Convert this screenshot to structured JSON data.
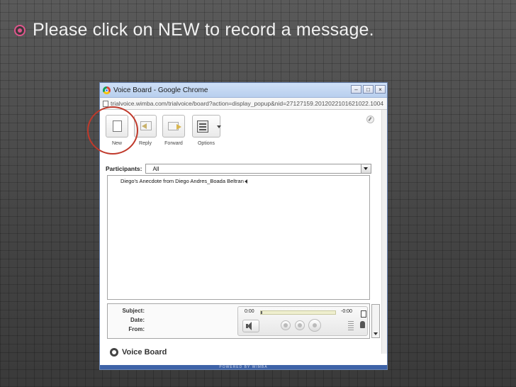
{
  "slide": {
    "bullet_text": "Please click on NEW to record a message."
  },
  "window": {
    "title": "Voice Board - Google Chrome",
    "url": "trialvoice.wimba.com/trialvoice/board?action=display_popup&nid=27127159.2012022101621022.1004",
    "controls": {
      "minimize": "–",
      "maximize": "□",
      "close": "×"
    }
  },
  "toolbar": {
    "new_label": "New",
    "reply_label": "Reply",
    "forward_label": "Forward",
    "options_label": "Options"
  },
  "participants": {
    "label": "Participants:",
    "selected": "All"
  },
  "messages": [
    {
      "title": "Diego's Anecdote",
      "separator": "from",
      "author": "Diego Andres_Boada Beltran"
    }
  ],
  "player": {
    "subject_label": "Subject:",
    "date_label": "Date:",
    "from_label": "From:",
    "time_elapsed": "0:00",
    "time_remaining": "-0:00",
    "progress": 0.02
  },
  "footer": {
    "brand": "Voice Board",
    "powered": "POWERED BY WIMBA"
  },
  "colors": {
    "accent_pink": "#e0558c",
    "highlight_red": "#c0392b",
    "status_blue": "#3e63a8"
  }
}
